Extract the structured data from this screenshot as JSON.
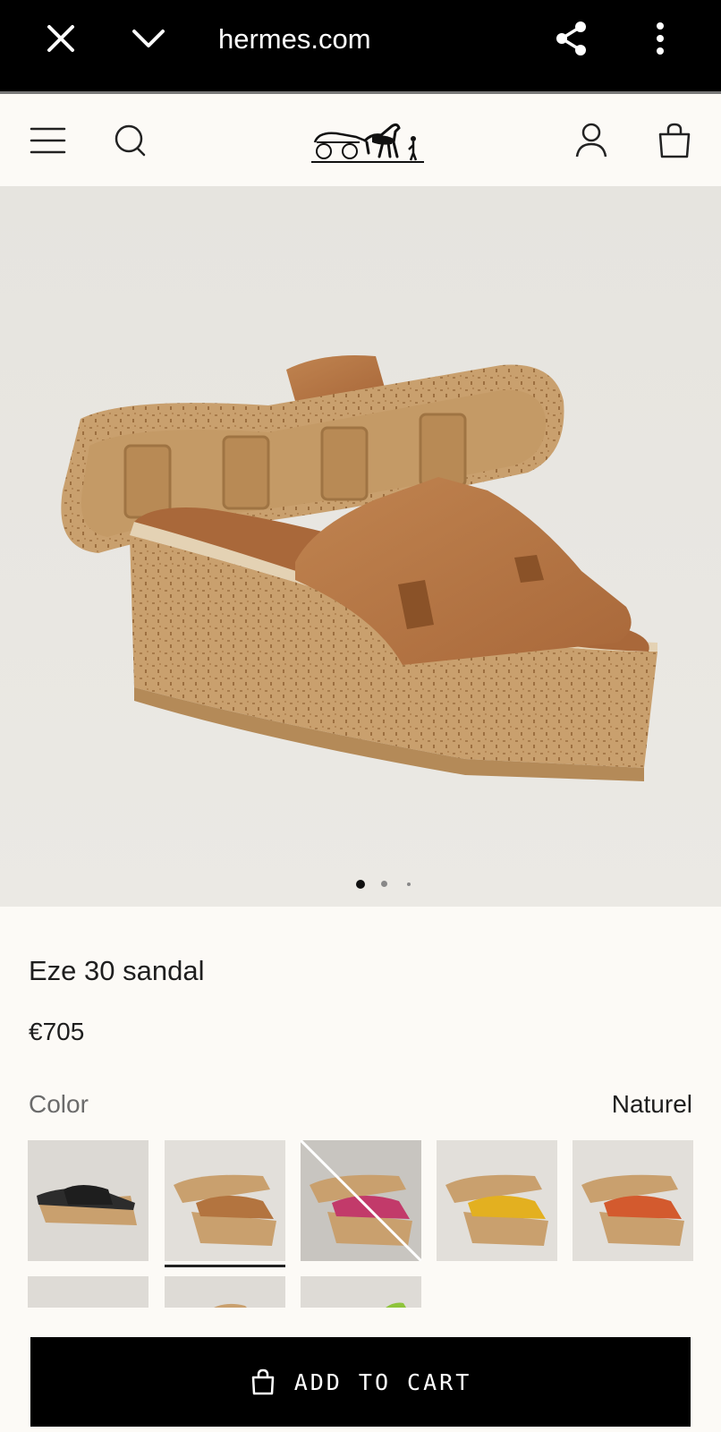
{
  "browser": {
    "url": "hermes.com"
  },
  "product": {
    "name": "Eze 30 sandal",
    "price": "€705",
    "color_label": "Color",
    "selected_color": "Naturel",
    "image_count": 3,
    "active_image": 1
  },
  "swatches": [
    {
      "color": "black",
      "strap_hex": "#2c2c2c",
      "state": "available"
    },
    {
      "color": "naturel",
      "strap_hex": "#b3743f",
      "state": "selected"
    },
    {
      "color": "pink",
      "strap_hex": "#c23a6a",
      "state": "unavailable"
    },
    {
      "color": "yellow",
      "strap_hex": "#e3b020",
      "state": "available"
    },
    {
      "color": "orange",
      "strap_hex": "#d35a2e",
      "state": "available"
    }
  ],
  "cart_button": {
    "label": "ADD TO CART"
  },
  "colors": {
    "page_bg": "#fcfaf6",
    "browser_bar": "#000000",
    "leather": "#b3743f",
    "cork": "#c9a06e"
  }
}
